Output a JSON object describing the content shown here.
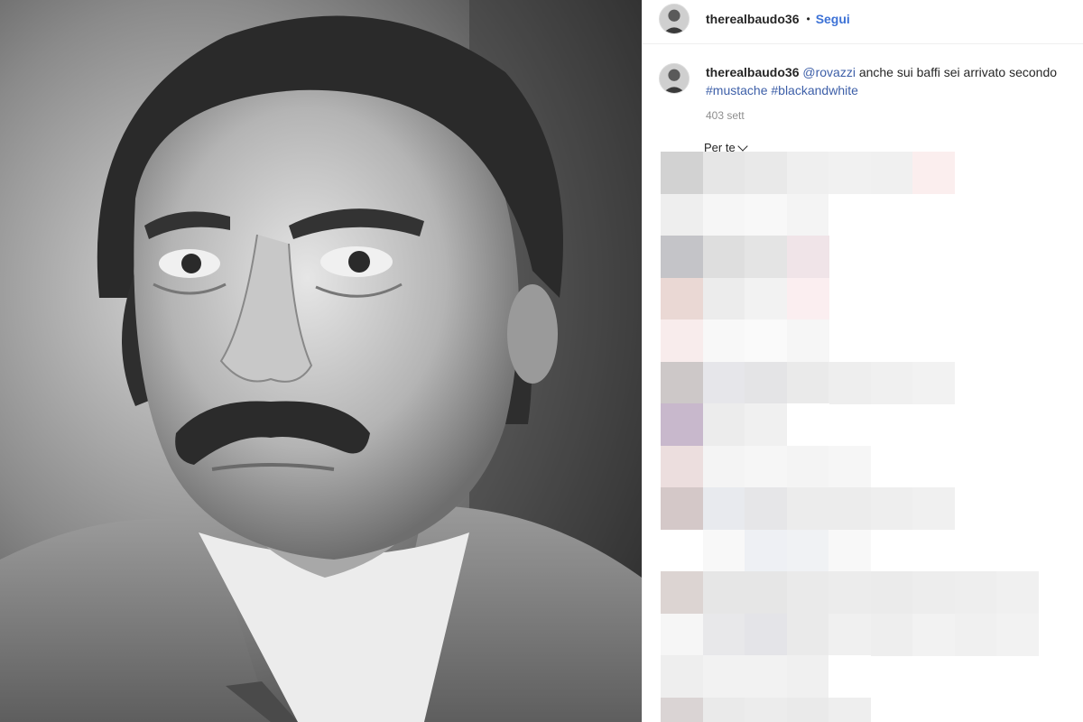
{
  "post": {
    "author": {
      "username": "therealbaudo36",
      "follow_label": "Segui",
      "separator": "•"
    },
    "caption": {
      "username": "therealbaudo36",
      "mention": "@rovazzi",
      "text": " anche sui baffi sei arrivato secondo",
      "hashtags": [
        "#mustache",
        "#blackandwhite"
      ],
      "age": "403 sett"
    },
    "comments": {
      "sort_label": "Per te"
    }
  },
  "colors": {
    "follow": "#3d72d6",
    "link": "#3d5fa8",
    "muted": "#8e8e8e"
  },
  "icons": {
    "sort_chevron": "chevron-down-icon"
  }
}
